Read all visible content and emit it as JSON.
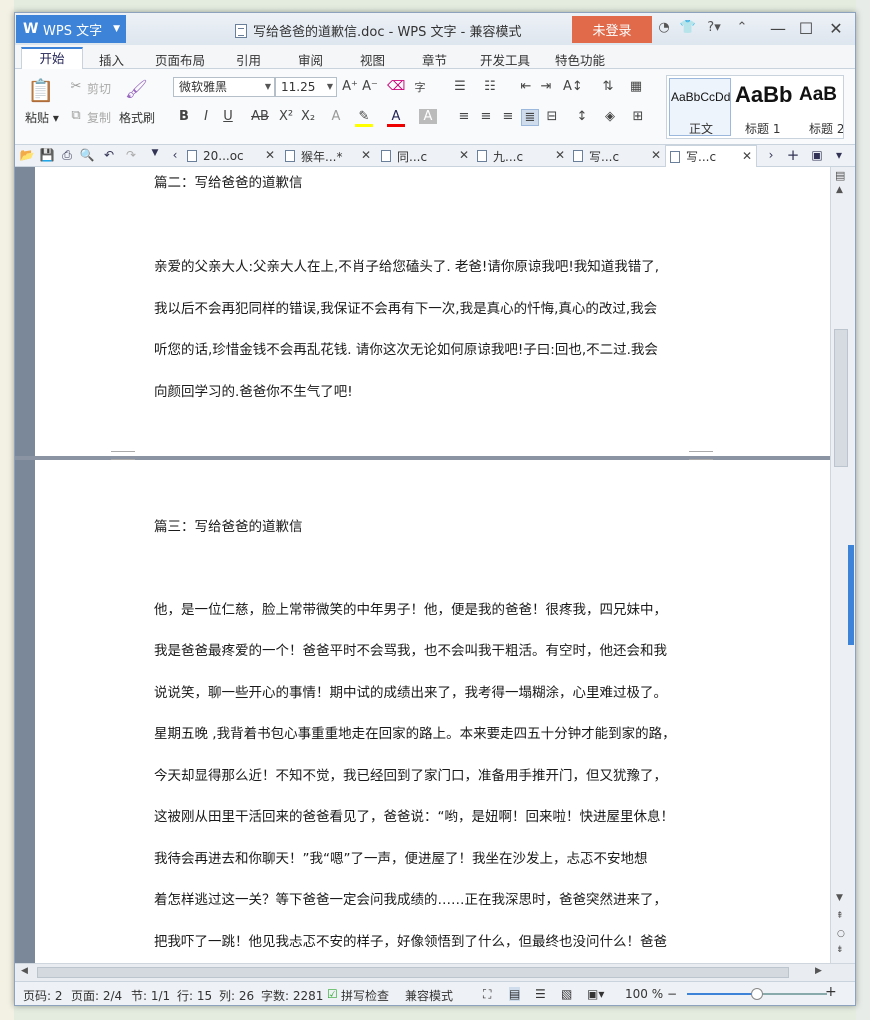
{
  "app": {
    "name": "WPS 文字",
    "title": "写给爸爸的道歉信.doc - WPS 文字 - 兼容模式",
    "login": "未登录",
    "help": "?"
  },
  "menu": {
    "tabs": [
      "开始",
      "插入",
      "页面布局",
      "引用",
      "审阅",
      "视图",
      "章节",
      "开发工具",
      "特色功能"
    ]
  },
  "ribbon": {
    "paste": "粘贴",
    "cut": "剪切",
    "copy": "复制",
    "format_painter": "格式刷",
    "font": "微软雅黑",
    "size": "11.25",
    "styles": [
      {
        "preview": "AaBbCcDd",
        "label": "正文"
      },
      {
        "preview": "AaBb",
        "label": "标题 1"
      },
      {
        "preview": "AaB",
        "label": "标题 2"
      }
    ]
  },
  "doc_tabs": [
    "20...oc",
    "猴年...*",
    "同...c",
    "九...c",
    "写...c",
    "写...c"
  ],
  "page1": {
    "heading": "篇二：写给爸爸的道歉信",
    "lines": [
      "亲爱的父亲大人:父亲大人在上,不肖子给您磕头了. 老爸!请你原谅我吧!我知道我错了,",
      "我以后不会再犯同样的错误,我保证不会再有下一次,我是真心的忏悔,真心的改过,我会",
      "听您的话,珍惜金钱不会再乱花钱. 请你这次无论如何原谅我吧!子曰:回也,不二过.我会",
      "向颜回学习的.爸爸你不生气了吧!"
    ]
  },
  "page2": {
    "heading": "篇三：写给爸爸的道歉信",
    "lines": [
      "他，是一位仁慈，脸上常带微笑的中年男子！他，便是我的爸爸！很疼我，四兄妹中，",
      "我是爸爸最疼爱的一个！爸爸平时不会骂我，也不会叫我干粗活。有空时，他还会和我",
      "说说笑，聊一些开心的事情！期中试的成绩出来了，我考得一塌糊涂，心里难过极了。",
      "星期五晚 ,我背着书包心事重重地走在回家的路上。本来要走四五十分钟才能到家的路，",
      "今天却显得那么近！不知不觉，我已经回到了家门口，准备用手推开门，但又犹豫了，",
      "这被刚从田里干活回来的爸爸看见了，爸爸说：“哟，是妞啊！回来啦！快进屋里休息！",
      "我待会再进去和你聊天！”我“嗯”了一声，便进屋了！我坐在沙发上，忐忑不安地想",
      "着怎样逃过这一关？等下爸爸一定会问我成绩的……正在我深思时，爸爸突然进来了，",
      "把我吓了一跳！他见我忐忑不安的样子，好像领悟到了什么，但最终也没问什么！爸爸"
    ]
  },
  "status": {
    "page_code": "页码: 2",
    "page": "页面: 2/4",
    "section": "节: 1/1",
    "row": "行: 15",
    "col": "列: 26",
    "words": "字数: 2281",
    "spell": "拼写检查",
    "mode": "兼容模式",
    "zoom": "100 %",
    "zoom_fraction": 0.5
  }
}
